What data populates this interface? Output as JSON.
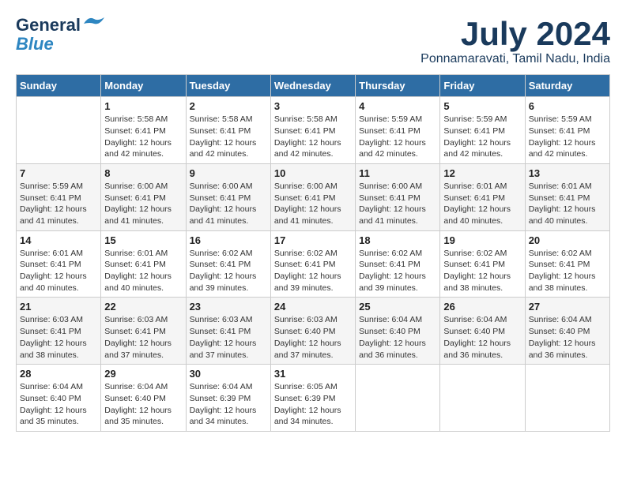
{
  "logo": {
    "line1": "General",
    "line2": "Blue"
  },
  "title": "July 2024",
  "subtitle": "Ponnamaravati, Tamil Nadu, India",
  "weekdays": [
    "Sunday",
    "Monday",
    "Tuesday",
    "Wednesday",
    "Thursday",
    "Friday",
    "Saturday"
  ],
  "weeks": [
    [
      {
        "day": null
      },
      {
        "day": 1,
        "sunrise": "5:58 AM",
        "sunset": "6:41 PM",
        "daylight": "12 hours and 42 minutes."
      },
      {
        "day": 2,
        "sunrise": "5:58 AM",
        "sunset": "6:41 PM",
        "daylight": "12 hours and 42 minutes."
      },
      {
        "day": 3,
        "sunrise": "5:58 AM",
        "sunset": "6:41 PM",
        "daylight": "12 hours and 42 minutes."
      },
      {
        "day": 4,
        "sunrise": "5:59 AM",
        "sunset": "6:41 PM",
        "daylight": "12 hours and 42 minutes."
      },
      {
        "day": 5,
        "sunrise": "5:59 AM",
        "sunset": "6:41 PM",
        "daylight": "12 hours and 42 minutes."
      },
      {
        "day": 6,
        "sunrise": "5:59 AM",
        "sunset": "6:41 PM",
        "daylight": "12 hours and 42 minutes."
      }
    ],
    [
      {
        "day": 7,
        "sunrise": "5:59 AM",
        "sunset": "6:41 PM",
        "daylight": "12 hours and 41 minutes."
      },
      {
        "day": 8,
        "sunrise": "6:00 AM",
        "sunset": "6:41 PM",
        "daylight": "12 hours and 41 minutes."
      },
      {
        "day": 9,
        "sunrise": "6:00 AM",
        "sunset": "6:41 PM",
        "daylight": "12 hours and 41 minutes."
      },
      {
        "day": 10,
        "sunrise": "6:00 AM",
        "sunset": "6:41 PM",
        "daylight": "12 hours and 41 minutes."
      },
      {
        "day": 11,
        "sunrise": "6:00 AM",
        "sunset": "6:41 PM",
        "daylight": "12 hours and 41 minutes."
      },
      {
        "day": 12,
        "sunrise": "6:01 AM",
        "sunset": "6:41 PM",
        "daylight": "12 hours and 40 minutes."
      },
      {
        "day": 13,
        "sunrise": "6:01 AM",
        "sunset": "6:41 PM",
        "daylight": "12 hours and 40 minutes."
      }
    ],
    [
      {
        "day": 14,
        "sunrise": "6:01 AM",
        "sunset": "6:41 PM",
        "daylight": "12 hours and 40 minutes."
      },
      {
        "day": 15,
        "sunrise": "6:01 AM",
        "sunset": "6:41 PM",
        "daylight": "12 hours and 40 minutes."
      },
      {
        "day": 16,
        "sunrise": "6:02 AM",
        "sunset": "6:41 PM",
        "daylight": "12 hours and 39 minutes."
      },
      {
        "day": 17,
        "sunrise": "6:02 AM",
        "sunset": "6:41 PM",
        "daylight": "12 hours and 39 minutes."
      },
      {
        "day": 18,
        "sunrise": "6:02 AM",
        "sunset": "6:41 PM",
        "daylight": "12 hours and 39 minutes."
      },
      {
        "day": 19,
        "sunrise": "6:02 AM",
        "sunset": "6:41 PM",
        "daylight": "12 hours and 38 minutes."
      },
      {
        "day": 20,
        "sunrise": "6:02 AM",
        "sunset": "6:41 PM",
        "daylight": "12 hours and 38 minutes."
      }
    ],
    [
      {
        "day": 21,
        "sunrise": "6:03 AM",
        "sunset": "6:41 PM",
        "daylight": "12 hours and 38 minutes."
      },
      {
        "day": 22,
        "sunrise": "6:03 AM",
        "sunset": "6:41 PM",
        "daylight": "12 hours and 37 minutes."
      },
      {
        "day": 23,
        "sunrise": "6:03 AM",
        "sunset": "6:41 PM",
        "daylight": "12 hours and 37 minutes."
      },
      {
        "day": 24,
        "sunrise": "6:03 AM",
        "sunset": "6:40 PM",
        "daylight": "12 hours and 37 minutes."
      },
      {
        "day": 25,
        "sunrise": "6:04 AM",
        "sunset": "6:40 PM",
        "daylight": "12 hours and 36 minutes."
      },
      {
        "day": 26,
        "sunrise": "6:04 AM",
        "sunset": "6:40 PM",
        "daylight": "12 hours and 36 minutes."
      },
      {
        "day": 27,
        "sunrise": "6:04 AM",
        "sunset": "6:40 PM",
        "daylight": "12 hours and 36 minutes."
      }
    ],
    [
      {
        "day": 28,
        "sunrise": "6:04 AM",
        "sunset": "6:40 PM",
        "daylight": "12 hours and 35 minutes."
      },
      {
        "day": 29,
        "sunrise": "6:04 AM",
        "sunset": "6:40 PM",
        "daylight": "12 hours and 35 minutes."
      },
      {
        "day": 30,
        "sunrise": "6:04 AM",
        "sunset": "6:39 PM",
        "daylight": "12 hours and 34 minutes."
      },
      {
        "day": 31,
        "sunrise": "6:05 AM",
        "sunset": "6:39 PM",
        "daylight": "12 hours and 34 minutes."
      },
      {
        "day": null
      },
      {
        "day": null
      },
      {
        "day": null
      }
    ]
  ]
}
